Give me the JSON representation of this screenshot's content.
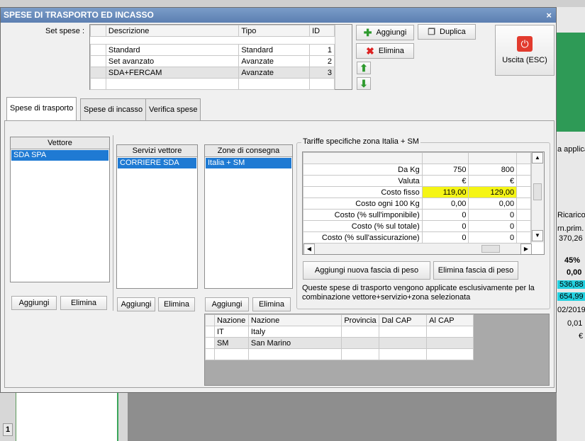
{
  "dialog": {
    "title": "SPESE DI TRASPORTO ED INCASSO",
    "close": "×"
  },
  "set_spese": {
    "label": "Set spese :",
    "columns": [
      "Descrizione",
      "Tipo",
      "ID"
    ],
    "rows": [
      {
        "descrizione": "Standard",
        "tipo": "Standard",
        "id": "1"
      },
      {
        "descrizione": "Set avanzato",
        "tipo": "Avanzate",
        "id": "2"
      },
      {
        "descrizione": "SDA+FERCAM",
        "tipo": "Avanzate",
        "id": "3"
      }
    ]
  },
  "buttons": {
    "aggiungi": "Aggiungi",
    "duplica": "Duplica",
    "elimina": "Elimina",
    "uscita": "Uscita (ESC)"
  },
  "tabs": [
    "Spese di trasporto",
    "Spese di incasso",
    "Verifica spese"
  ],
  "vettore": {
    "header": "Vettore",
    "items": [
      "SDA SPA"
    ],
    "add": "Aggiungi",
    "remove": "Elimina"
  },
  "servizi": {
    "header": "Servizi vettore",
    "items": [
      "CORRIERE SDA"
    ],
    "add": "Aggiungi",
    "remove": "Elimina"
  },
  "zone": {
    "header": "Zone di consegna",
    "items": [
      "Italia + SM"
    ],
    "add": "Aggiungi",
    "remove": "Elimina"
  },
  "tariffe": {
    "group_title": "Tariffe specifiche zona Italia + SM",
    "rows": [
      {
        "label": "Da Kg",
        "v1": "750",
        "v2": "800"
      },
      {
        "label": "Valuta",
        "v1": "€",
        "v2": "€"
      },
      {
        "label": "Costo fisso",
        "v1": "119,00",
        "v2": "129,00"
      },
      {
        "label": "Costo ogni 100 Kg",
        "v1": "0,00",
        "v2": "0,00"
      },
      {
        "label": "Costo (% sull'imponibile)",
        "v1": "0",
        "v2": "0"
      },
      {
        "label": "Costo (% sul totale)",
        "v1": "0",
        "v2": "0"
      },
      {
        "label": "Costo (% sull'assicurazione)",
        "v1": "0",
        "v2": "0"
      }
    ],
    "add_fascia": "Aggiungi nuova fascia di peso",
    "del_fascia": "Elimina fascia di peso",
    "note": "Queste spese di trasporto vengono applicate esclusivamente per la combinazione vettore+servizio+zona selezionata",
    "highlight_color": "#f5f515"
  },
  "nazioni": {
    "columns": [
      "Nazione",
      "Nazione",
      "Provincia",
      "Dal CAP",
      "Al CAP"
    ],
    "rows": [
      {
        "code": "IT",
        "name": "Italy"
      },
      {
        "code": "SM",
        "name": "San Marino"
      }
    ]
  },
  "background": {
    "right_texts": [
      "a applica",
      "Ricarico",
      "rn.prim.",
      "370,26",
      "45%",
      "0,00",
      "536,88",
      "654,99",
      "02/2019",
      "0,01",
      "€"
    ],
    "row_number": "1"
  }
}
